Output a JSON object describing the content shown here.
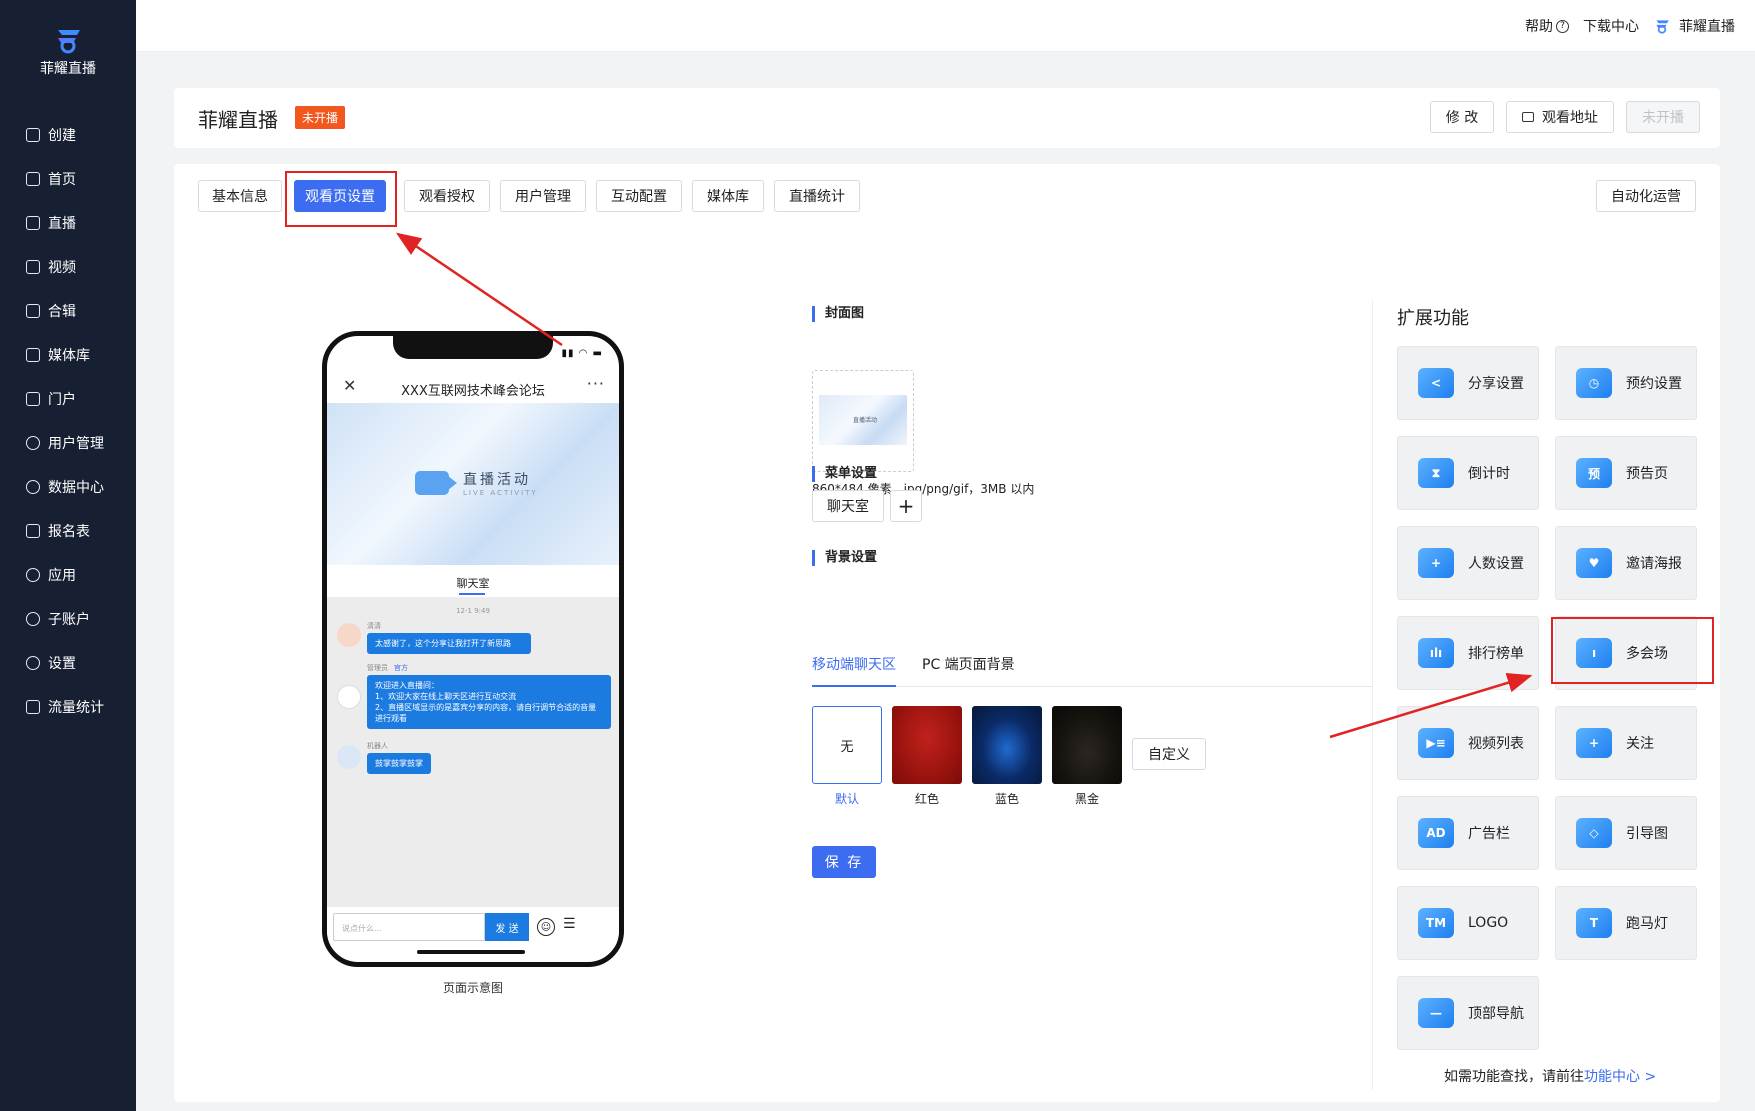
{
  "sidebar": {
    "brand": "菲耀直播",
    "items": [
      {
        "label": "创建",
        "icon": "plus-square-icon"
      },
      {
        "label": "首页",
        "icon": "home-icon"
      },
      {
        "label": "直播",
        "icon": "live-icon"
      },
      {
        "label": "视频",
        "icon": "video-icon"
      },
      {
        "label": "合辑",
        "icon": "collection-icon"
      },
      {
        "label": "媒体库",
        "icon": "media-icon"
      },
      {
        "label": "门户",
        "icon": "portal-icon"
      },
      {
        "label": "用户管理",
        "icon": "user-icon"
      },
      {
        "label": "数据中心",
        "icon": "chart-pie-icon"
      },
      {
        "label": "报名表",
        "icon": "form-icon"
      },
      {
        "label": "应用",
        "icon": "app-icon"
      },
      {
        "label": "子账户",
        "icon": "sub-account-icon"
      },
      {
        "label": "设置",
        "icon": "settings-icon"
      },
      {
        "label": "流量统计",
        "icon": "traffic-icon"
      }
    ]
  },
  "topbar": {
    "help": "帮助",
    "download": "下载中心",
    "account": "菲耀直播"
  },
  "header": {
    "title": "菲耀直播",
    "status": "未开播",
    "edit": "修 改",
    "watch_url": "观看地址",
    "not_live": "未开播"
  },
  "tabs": [
    "基本信息",
    "观看页设置",
    "观看授权",
    "用户管理",
    "互动配置",
    "媒体库",
    "直播统计"
  ],
  "auto_ops": "自动化运营",
  "phone": {
    "title": "XXX互联网技术峰会论坛",
    "banner_title": "直播活动",
    "banner_sub": "LIVE ACTIVITY",
    "chat_tab": "聊天室",
    "time": "12-1 9:49",
    "messages": [
      {
        "nick": "清清",
        "tag": "",
        "text": "太感谢了，这个分享让我打开了新思路"
      },
      {
        "nick": "管理员",
        "tag": "官方",
        "text": "欢迎进入直播间：\n1、欢迎大家在线上聊天区进行互动交流\n2、直播区域显示的是嘉宾分享的内容，请自行调节合适的音量进行观看"
      },
      {
        "nick": "机器人",
        "tag": "",
        "text": "鼓掌鼓掌鼓掌"
      }
    ],
    "input_placeholder": "说点什么...",
    "send": "发 送",
    "caption": "页面示意图"
  },
  "settings": {
    "cover_title": "封面图",
    "cover_thumb_text": "直播活动",
    "cover_hint": "860*484 像素，jpg/png/gif，3MB 以内",
    "menu_title": "菜单设置",
    "menu_item": "聊天室",
    "menu_add": "+",
    "bg_title": "背景设置",
    "bg_tabs": [
      "移动端聊天区",
      "PC 端页面背景"
    ],
    "swatch_none": "无",
    "swatches": [
      "默认",
      "红色",
      "蓝色",
      "黑金"
    ],
    "custom": "自定义",
    "save": "保 存"
  },
  "extensions": {
    "title": "扩展功能",
    "items": [
      {
        "label": "分享设置",
        "icon": "share-icon",
        "glyph": "<"
      },
      {
        "label": "预约设置",
        "icon": "clock-icon",
        "glyph": "◷"
      },
      {
        "label": "倒计时",
        "icon": "hourglass-icon",
        "glyph": "⧗"
      },
      {
        "label": "预告页",
        "icon": "preview-icon",
        "glyph": "预"
      },
      {
        "label": "人数设置",
        "icon": "user-add-icon",
        "glyph": "+"
      },
      {
        "label": "邀请海报",
        "icon": "heart-icon",
        "glyph": "♥"
      },
      {
        "label": "排行榜单",
        "icon": "bar-chart-icon",
        "glyph": "ılı"
      },
      {
        "label": "多会场",
        "icon": "venue-icon",
        "glyph": "ı"
      },
      {
        "label": "视频列表",
        "icon": "video-list-icon",
        "glyph": "▶≡"
      },
      {
        "label": "关注",
        "icon": "follow-icon",
        "glyph": "+"
      },
      {
        "label": "广告栏",
        "icon": "ad-icon",
        "glyph": "AD"
      },
      {
        "label": "引导图",
        "icon": "guide-icon",
        "glyph": "◇"
      },
      {
        "label": "LOGO",
        "icon": "logo-icon",
        "glyph": "TM"
      },
      {
        "label": "跑马灯",
        "icon": "marquee-icon",
        "glyph": "T"
      },
      {
        "label": "顶部导航",
        "icon": "top-nav-icon",
        "glyph": "—"
      }
    ],
    "footer_text": "如需功能查找，请前往",
    "footer_link": "功能中心 >"
  }
}
